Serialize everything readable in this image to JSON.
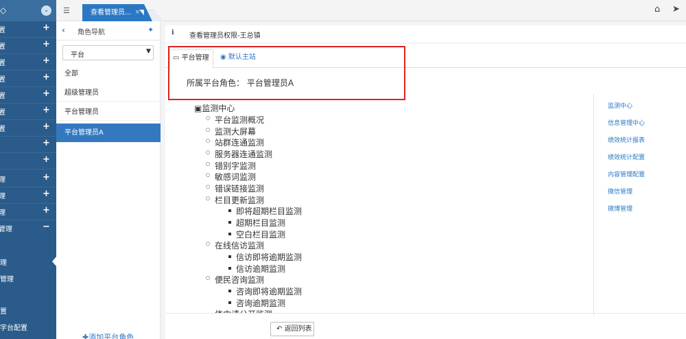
{
  "header": {
    "tab_label": "查看管理员...",
    "tab_close": "×"
  },
  "sidebar": {
    "items": [
      {
        "label": "置",
        "toggle": "+"
      },
      {
        "label": "置",
        "toggle": "+"
      },
      {
        "label": "置",
        "toggle": "+"
      },
      {
        "label": "置",
        "toggle": "+"
      },
      {
        "label": "置",
        "toggle": "+"
      },
      {
        "label": "置",
        "toggle": "+"
      },
      {
        "label": "置",
        "toggle": "+"
      },
      {
        "label": "",
        "toggle": "+"
      },
      {
        "label": "",
        "toggle": "+"
      },
      {
        "label": "理",
        "toggle": "+"
      },
      {
        "label": "理",
        "toggle": "+"
      },
      {
        "label": "理",
        "toggle": "+"
      },
      {
        "label": "管理",
        "toggle": "−"
      }
    ],
    "subitems": [
      "理",
      "管理",
      "置",
      "字台配置"
    ]
  },
  "role_nav": {
    "title": "角色导航",
    "select_value": "平台",
    "items": [
      "全部",
      "超级管理员",
      "平台管理员",
      "平台管理员A"
    ],
    "add_label": "✚添加平台角色"
  },
  "main": {
    "breadcrumb": "查看管理员权限-王总镇",
    "tabs": [
      "平台管理",
      "默认主站"
    ],
    "role_label": "所属平台角色：",
    "role_value": "平台管理员A",
    "tree_root": "监测中心",
    "tree": [
      {
        "label": "平台监测概况",
        "level": 1
      },
      {
        "label": "监测大屏幕",
        "level": 1
      },
      {
        "label": "站群连通监测",
        "level": 1
      },
      {
        "label": "服务器连通监测",
        "level": 1
      },
      {
        "label": "错别字监测",
        "level": 1
      },
      {
        "label": "敏感词监测",
        "level": 1
      },
      {
        "label": "错误链接监测",
        "level": 1
      },
      {
        "label": "栏目更新监测",
        "level": 1
      },
      {
        "label": "即将超期栏目监测",
        "level": 2
      },
      {
        "label": "超期栏目监测",
        "level": 2
      },
      {
        "label": "空白栏目监测",
        "level": 2
      },
      {
        "label": "在线信访监测",
        "level": 1
      },
      {
        "label": "信访即将逾期监测",
        "level": 2
      },
      {
        "label": "信访逾期监测",
        "level": 2
      },
      {
        "label": "便民咨询监测",
        "level": 1
      },
      {
        "label": "咨询即将逾期监测",
        "level": 2
      },
      {
        "label": "咨询逾期监测",
        "level": 2
      },
      {
        "label": "体由请公开监测",
        "level": 1
      }
    ],
    "right_links": [
      "监测中心",
      "信息管理中心",
      "绩效统计报表",
      "绩效统计配置",
      "内容管理配置",
      "微信管理",
      "微博管理"
    ],
    "back_button": "返回列表"
  }
}
